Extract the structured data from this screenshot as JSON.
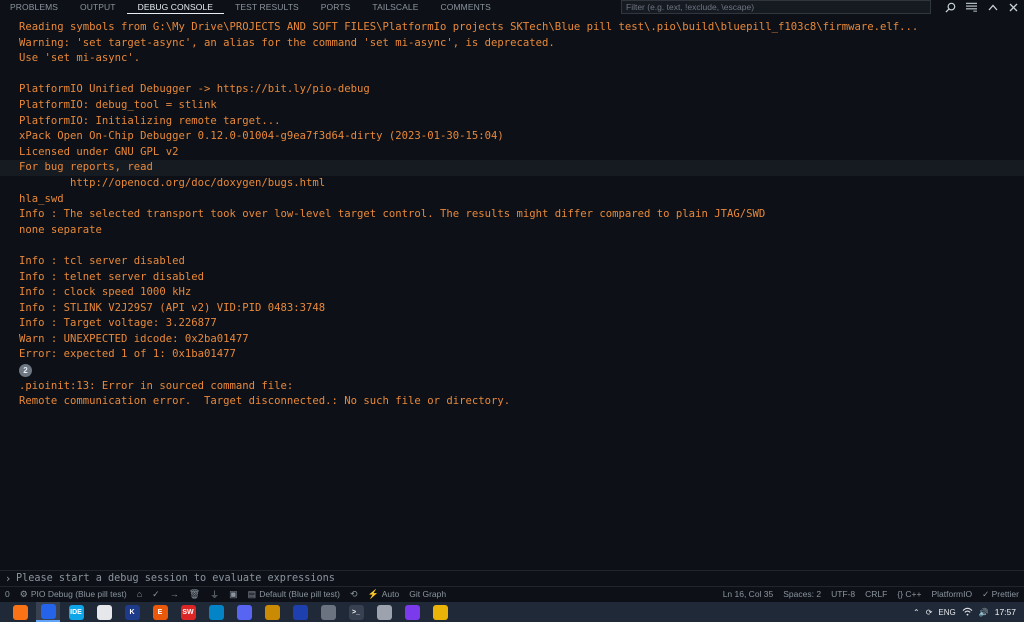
{
  "tabs": [
    {
      "label": "PROBLEMS",
      "active": false
    },
    {
      "label": "OUTPUT",
      "active": false
    },
    {
      "label": "DEBUG CONSOLE",
      "active": true
    },
    {
      "label": "TEST RESULTS",
      "active": false
    },
    {
      "label": "PORTS",
      "active": false
    },
    {
      "label": "TAILSCALE",
      "active": false
    },
    {
      "label": "COMMENTS",
      "active": false
    }
  ],
  "filter": {
    "placeholder": "Filter (e.g. text, !exclude, \\escape)"
  },
  "toolbar_icons": [
    "search-icon",
    "filter-list-icon",
    "chevron-up-icon",
    "close-icon"
  ],
  "console": {
    "lines": [
      "Reading symbols from G:\\My Drive\\PROJECTS AND SOFT FILES\\PlatformIo projects SKTech\\Blue pill test\\.pio\\build\\bluepill_f103c8\\firmware.elf...",
      "Warning: 'set target-async', an alias for the command 'set mi-async', is deprecated.",
      "Use 'set mi-async'.",
      "",
      "PlatformIO Unified Debugger -> https://bit.ly/pio-debug",
      "PlatformIO: debug_tool = stlink",
      "PlatformIO: Initializing remote target...",
      "xPack Open On-Chip Debugger 0.12.0-01004-g9ea7f3d64-dirty (2023-01-30-15:04)",
      "Licensed under GNU GPL v2",
      "For bug reports, read",
      "        http://openocd.org/doc/doxygen/bugs.html",
      "hla_swd",
      "Info : The selected transport took over low-level target control. The results might differ compared to plain JTAG/SWD",
      "none separate",
      "",
      "Info : tcl server disabled",
      "Info : telnet server disabled",
      "Info : clock speed 1000 kHz",
      "Info : STLINK V2J29S7 (API v2) VID:PID 0483:3748",
      "Info : Target voltage: 3.226877",
      "Warn : UNEXPECTED idcode: 0x2ba01477",
      "Error: expected 1 of 1: 0x1ba01477"
    ],
    "repeat_badge": "2",
    "error_lines": [
      ".pioinit:13: Error in sourced command file:",
      "Remote communication error.  Target disconnected.: No such file or directory."
    ]
  },
  "input": {
    "placeholder": "Please start a debug session to evaluate expressions",
    "prompt": "›"
  },
  "statusbar": {
    "left": [
      {
        "icon": "",
        "label": "0"
      },
      {
        "icon": "debug-icon",
        "label": "PIO Debug (Blue pill test)"
      },
      {
        "icon": "home-icon",
        "label": ""
      },
      {
        "icon": "check-icon",
        "label": ""
      },
      {
        "icon": "arrow-right-icon",
        "label": ""
      },
      {
        "icon": "trash-icon",
        "label": ""
      },
      {
        "icon": "plug-icon",
        "label": ""
      },
      {
        "icon": "terminal-icon",
        "label": ""
      },
      {
        "icon": "folder-icon",
        "label": "Default (Blue pill test)"
      },
      {
        "icon": "sync-icon",
        "label": ""
      },
      {
        "icon": "lightning-icon",
        "label": "Auto"
      },
      {
        "icon": "",
        "label": "Git Graph"
      }
    ],
    "right": [
      {
        "label": "Ln 16, Col 35"
      },
      {
        "label": "Spaces: 2"
      },
      {
        "label": "UTF-8"
      },
      {
        "label": "CRLF"
      },
      {
        "label": "{} C++"
      },
      {
        "label": "PlatformIO"
      },
      {
        "label": "✓ Prettier"
      }
    ]
  },
  "taskbar": {
    "apps": [
      {
        "name": "firefox",
        "color": "#f97316",
        "glyph": ""
      },
      {
        "name": "vscode",
        "color": "#2563eb",
        "glyph": "",
        "active": true
      },
      {
        "name": "ide",
        "color": "#0ea5e9",
        "glyph": "IDE"
      },
      {
        "name": "app-white",
        "color": "#e5e7eb",
        "glyph": ""
      },
      {
        "name": "app-k",
        "color": "#1e3a8a",
        "glyph": "K"
      },
      {
        "name": "app-e",
        "color": "#ea580c",
        "glyph": "E"
      },
      {
        "name": "app-sw",
        "color": "#dc2626",
        "glyph": "SW"
      },
      {
        "name": "telegram",
        "color": "#0284c7",
        "glyph": ""
      },
      {
        "name": "discord",
        "color": "#5865f2",
        "glyph": ""
      },
      {
        "name": "app-gold",
        "color": "#ca8a04",
        "glyph": ""
      },
      {
        "name": "steam",
        "color": "#1e40af",
        "glyph": ""
      },
      {
        "name": "app-gray",
        "color": "#6b7280",
        "glyph": ""
      },
      {
        "name": "terminal",
        "color": "#374151",
        "glyph": ">_"
      },
      {
        "name": "app-mascot",
        "color": "#9ca3af",
        "glyph": ""
      },
      {
        "name": "app-purple",
        "color": "#7c3aed",
        "glyph": ""
      },
      {
        "name": "files",
        "color": "#eab308",
        "glyph": ""
      }
    ],
    "tray": {
      "lang": "ENG",
      "time": "17:57"
    }
  }
}
